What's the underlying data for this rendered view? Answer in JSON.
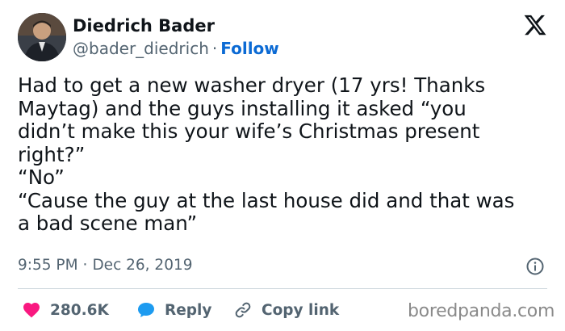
{
  "author": {
    "name": "Diedrich Bader",
    "handle": "@bader_diedrich",
    "separator": "·",
    "follow_label": "Follow"
  },
  "tweet": {
    "text": "Had to get a new washer dryer (17 yrs! Thanks\nMaytag) and the guys installing it asked “you\ndidn’t make this your wife’s Christmas present\nright?”\n“No”\n“Cause the guy at the last house did and that was\na bad scene man”",
    "time": "9:55 PM",
    "separator": "·",
    "date": "Dec 26, 2019"
  },
  "actions": {
    "likes": "280.6K",
    "reply_label": "Reply",
    "copy_link_label": "Copy link"
  },
  "icons": {
    "logo": "x-logo-icon",
    "info": "info-icon",
    "heart": "heart-icon",
    "reply": "reply-bubble-icon",
    "link": "link-icon"
  },
  "colors": {
    "text": "#0f1419",
    "secondary": "#536471",
    "follow": "#0b6ad4",
    "heart": "#f91880",
    "reply": "#1d9bf0",
    "divider": "#cfd9de"
  },
  "watermark": "boredpanda.com"
}
